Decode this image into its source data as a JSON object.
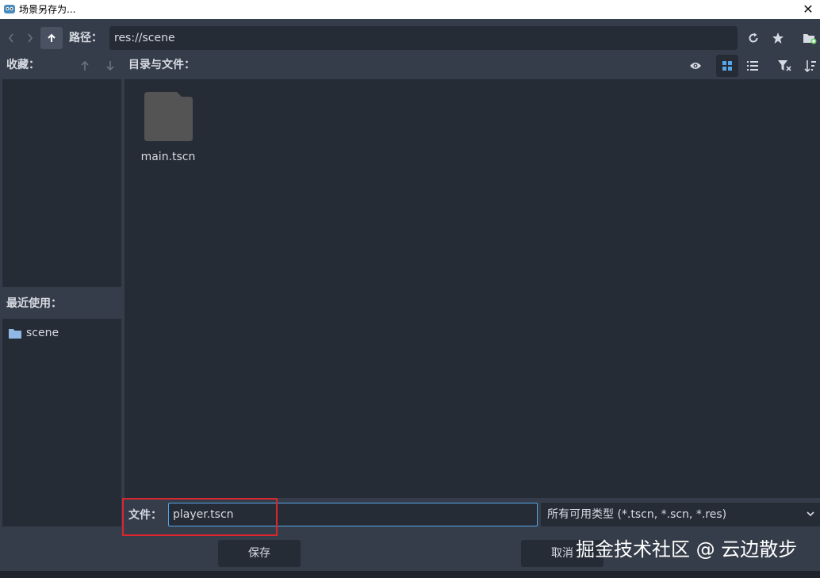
{
  "window": {
    "title": "场景另存为...",
    "app_icon": "godot-icon",
    "close_glyph": "✕"
  },
  "toolbar": {
    "path_label": "路径：",
    "path_value": "res://scene"
  },
  "favorites": {
    "label": "收藏："
  },
  "recent": {
    "label": "最近使用：",
    "items": [
      {
        "label": "scene"
      }
    ]
  },
  "files": {
    "label": "目录与文件：",
    "items": [
      {
        "label": "main.tscn"
      }
    ]
  },
  "save_row": {
    "file_label": "文件：",
    "file_value": "player.tscn",
    "filter_value": "所有可用类型 (*.tscn, *.scn, *.res)"
  },
  "buttons": {
    "save": "保存",
    "cancel": "取消"
  },
  "watermark": "掘金技术社区 @ 云边散步",
  "colors": {
    "accent": "#57a6e8",
    "highlight": "#d9262f",
    "panel": "#262c36",
    "background": "#363d4a"
  }
}
